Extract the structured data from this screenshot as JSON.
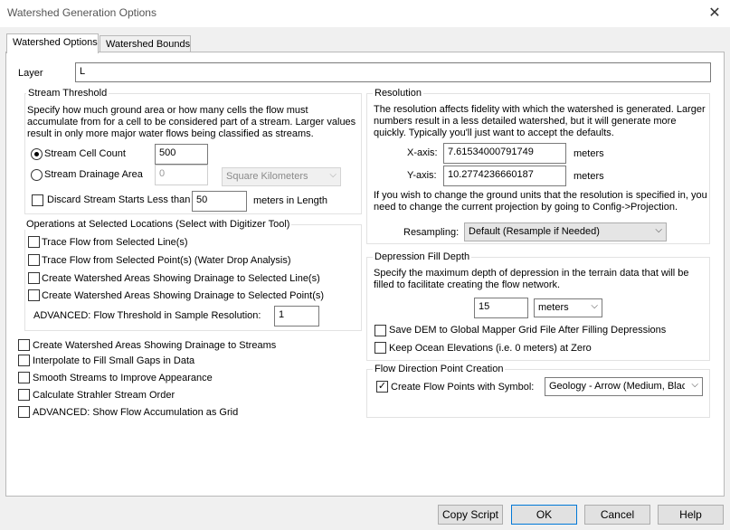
{
  "window": {
    "title": "Watershed Generation Options",
    "close_glyph": "✕"
  },
  "tabs": [
    {
      "label": "Watershed Options",
      "active": true
    },
    {
      "label": "Watershed Bounds",
      "active": false
    }
  ],
  "layer": {
    "label": "Layer",
    "value": "L"
  },
  "stream_threshold": {
    "title": "Stream Threshold",
    "description": "Specify how much ground area or how many cells the flow must accumulate from for a cell to be considered part of a stream. Larger values result in only more major water flows being classified as streams.",
    "cell_count": {
      "label": "Stream Cell Count",
      "value": "500",
      "selected": true
    },
    "drainage_area": {
      "label": "Stream Drainage Area",
      "value": "0",
      "unit": "Square Kilometers",
      "selected": false
    },
    "discard": {
      "label": "Discard Stream Starts Less than",
      "value": "50",
      "suffix": "meters in Length",
      "checked": false
    }
  },
  "operations": {
    "title": "Operations at Selected Locations (Select with Digitizer Tool)",
    "items": [
      {
        "label": "Trace Flow from Selected Line(s)",
        "checked": false
      },
      {
        "label": "Trace Flow from Selected Point(s) (Water Drop Analysis)",
        "checked": false
      },
      {
        "label": "Create Watershed Areas Showing Drainage to Selected Line(s)",
        "checked": false
      },
      {
        "label": "Create Watershed Areas Showing Drainage to Selected Point(s)",
        "checked": false
      }
    ],
    "advanced_label": "ADVANCED: Flow Threshold in Sample Resolution:",
    "advanced_value": "1"
  },
  "general_options": [
    {
      "label": "Create Watershed Areas Showing Drainage to Streams",
      "checked": false
    },
    {
      "label": "Interpolate to Fill Small Gaps in Data",
      "checked": false
    },
    {
      "label": "Smooth Streams to Improve Appearance",
      "checked": false
    },
    {
      "label": "Calculate Strahler Stream Order",
      "checked": false
    },
    {
      "label": "ADVANCED: Show Flow Accumulation as Grid",
      "checked": false
    }
  ],
  "resolution": {
    "title": "Resolution",
    "description": "The resolution affects fidelity with which the watershed is generated. Larger numbers result in a less detailed watershed, but it will generate more quickly. Typically you'll just want to accept the defaults.",
    "x_label": "X-axis:",
    "x_value": "7.61534000791749",
    "y_label": "Y-axis:",
    "y_value": "10.2774236660187",
    "unit": "meters",
    "note": "If you wish to change the ground units that the resolution is specified in, you need to change the current projection by going to Config->Projection.",
    "resampling_label": "Resampling:",
    "resampling_value": "Default (Resample if Needed)"
  },
  "depression": {
    "title": "Depression Fill Depth",
    "description": "Specify the maximum depth of depression in the terrain data that will be filled to facilitate creating the flow network.",
    "value": "15",
    "unit": "meters",
    "save_dem": {
      "label": "Save DEM to Global Mapper Grid File After Filling Depressions",
      "checked": false
    },
    "keep_ocean": {
      "label": "Keep Ocean Elevations (i.e. 0 meters) at Zero",
      "checked": false
    }
  },
  "flow_direction": {
    "title": "Flow Direction Point Creation",
    "create_label": "Create Flow Points with Symbol:",
    "checked": true,
    "symbol_value": "Geology - Arrow (Medium, Black)"
  },
  "buttons": {
    "copy_script": "Copy Script",
    "ok": "OK",
    "cancel": "Cancel",
    "help": "Help"
  },
  "glyphs": {
    "check": "✓",
    "dropdown": "⌵"
  }
}
